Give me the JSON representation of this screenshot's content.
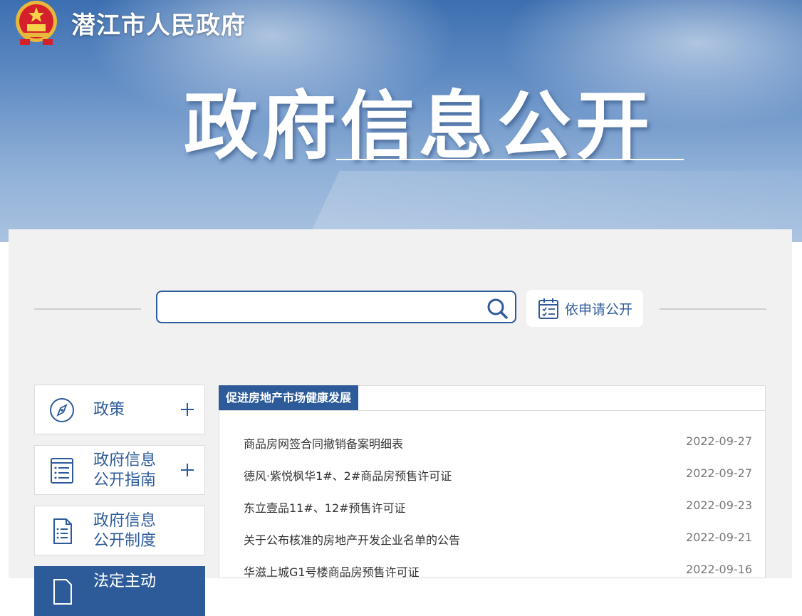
{
  "header": {
    "site_title": "潜江市人民政府",
    "banner_heading": "政府信息公开"
  },
  "search": {
    "placeholder": ""
  },
  "apply_button": {
    "label": "依申请公开"
  },
  "sidebar": {
    "items": [
      {
        "line1": "政策",
        "line2": "",
        "icon": "compass-icon",
        "expandable": true
      },
      {
        "line1": "政府信息",
        "line2": "公开指南",
        "icon": "list-document-icon",
        "expandable": true
      },
      {
        "line1": "政府信息",
        "line2": "公开制度",
        "icon": "document-icon",
        "expandable": false
      },
      {
        "line1": "法定主动",
        "line2": "",
        "icon": "document-icon",
        "expandable": false,
        "active": true
      }
    ]
  },
  "content": {
    "tab_title": "促进房地产市场健康发展",
    "items": [
      {
        "title": "商品房网签合同撤销备案明细表",
        "date": "2022-09-27"
      },
      {
        "title": "德风·紫悦枫华1#、2#商品房预售许可证",
        "date": "2022-09-27"
      },
      {
        "title": "东立壹品11#、12#预售许可证",
        "date": "2022-09-23"
      },
      {
        "title": "关于公布核准的房地产开发企业名单的公告",
        "date": "2022-09-21"
      },
      {
        "title": "华滋上城G1号楼商品房预售许可证",
        "date": "2022-09-16"
      }
    ]
  },
  "colors": {
    "primary": "#2d5b9a",
    "panel_bg": "#f1f1f1",
    "date_text": "#777777"
  }
}
